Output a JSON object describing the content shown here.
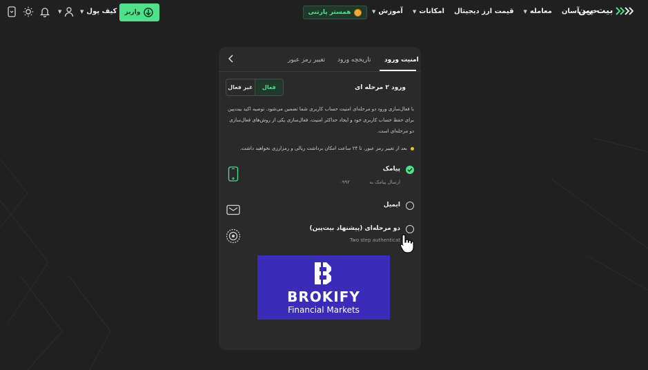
{
  "header": {
    "logo_text": "بیت پین",
    "nav": [
      {
        "label": "خرید آسان"
      },
      {
        "label": "معامله"
      },
      {
        "label": "قیمت ارز دیجیتال"
      },
      {
        "label": "امکانات"
      },
      {
        "label": "آموزش"
      }
    ],
    "partner_label": "همستر پارتنی",
    "deposit_label": "واریز",
    "wallet_label": "کیف پول"
  },
  "card": {
    "tabs": [
      {
        "label": "امنیت ورود",
        "active": true
      },
      {
        "label": "تاریخچه ورود",
        "active": false
      },
      {
        "label": "تغییر رمز عبور",
        "active": false
      }
    ],
    "twofa_title": "ورود ۲ مرحله ای",
    "toggle": {
      "off_label": "غیر فعال",
      "on_label": "فعال"
    },
    "description": "با فعال‌سازی ورود دو مرحله‌ای امنیت حساب کاربری شما تضمین می‌شود. توصیه اکید بیت‌پین برای حفظ حساب کاربری خود و ایجاد حداکثر امنیت، فعال‌سازی یکی از روش‌های فعال‌سازی دو مرحله‌ای است.",
    "note": "بعد از تغییر رمز عبور، تا ۲۴ ساعت امکان برداشت ریالی و رمزارزی نخواهید داشت.",
    "methods": [
      {
        "title": "پیامک",
        "subtitle": "ارسال پیامک به",
        "phone": "۰۹۹۲",
        "checked": true
      },
      {
        "title": "ایمیل",
        "subtitle": "",
        "phone": "",
        "checked": false
      },
      {
        "title": "دو مرحله‌ای (پیشنهاد بیت‌پین)",
        "subtitle": "Two step authenticat",
        "phone": "",
        "checked": false
      }
    ],
    "ad": {
      "brand": "BROKIFY",
      "tagline": "Financial Markets"
    }
  },
  "colors": {
    "background": "#202020",
    "card": "#2a2a2a",
    "accent": "#4ee08a",
    "ad_bg": "#3a2bb8"
  }
}
